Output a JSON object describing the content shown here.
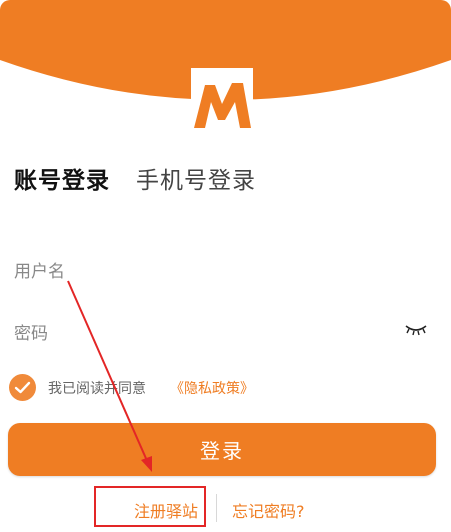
{
  "colors": {
    "brand_orange": "#ef7d23",
    "annotation_red": "#e32626"
  },
  "header": {
    "logo_icon": "m-logo-icon"
  },
  "tabs": {
    "account_login": "账号登录",
    "phone_login": "手机号登录"
  },
  "form": {
    "username_placeholder": "用户名",
    "password_placeholder": "密码",
    "password_toggle_icon": "eye-closed-icon"
  },
  "agreement": {
    "checked": true,
    "text": "我已阅读并同意",
    "policy_link": "《隐私政策》"
  },
  "actions": {
    "login_label": "登录",
    "register_label": "注册驿站",
    "forgot_label": "忘记密码?"
  }
}
